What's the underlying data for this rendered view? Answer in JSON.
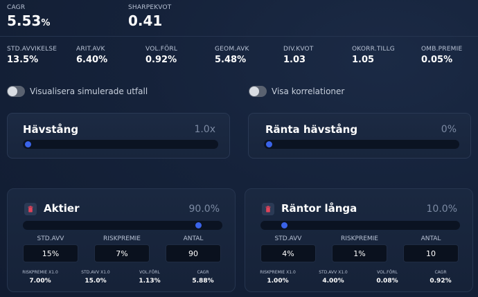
{
  "top_stats": {
    "cagr": {
      "label": "CAGR",
      "value": "5.53",
      "unit": "%"
    },
    "sharpe": {
      "label": "SHARPEKVOT",
      "value": "0.41"
    }
  },
  "metrics": [
    {
      "label": "STD.AVVIKELSE",
      "value": "13.5%"
    },
    {
      "label": "ARIT.AVK",
      "value": "6.40%"
    },
    {
      "label": "VOL.FÖRL",
      "value": "0.92%"
    },
    {
      "label": "GEOM.AVK",
      "value": "5.48%"
    },
    {
      "label": "DIV.KVOT",
      "value": "1.03"
    },
    {
      "label": "OKORR.TILLG",
      "value": "1.05"
    },
    {
      "label": "OMB.PREMIE",
      "value": "0.05%"
    }
  ],
  "toggles": {
    "simulate": {
      "label": "Visualisera simulerade utfall",
      "on": false
    },
    "correlations": {
      "label": "Visa korrelationer",
      "on": false
    }
  },
  "leverage": {
    "title": "Hävstång",
    "value": "1.0x",
    "level": 0.0
  },
  "rate_leverage": {
    "title": "Ränta hävstång",
    "value": "0%",
    "level": 0.0
  },
  "assets": [
    {
      "title": "Aktier",
      "pct": "90.0%",
      "level": 0.9,
      "inputs": {
        "std_label": "STD.AVV",
        "std": "15%",
        "risk_label": "RISKPREMIE",
        "risk": "7%",
        "count_label": "ANTAL",
        "count": "90"
      },
      "mini": [
        {
          "label": "RISKPREMIE x1.0",
          "value": "7.00%"
        },
        {
          "label": "STD.AVV x1.0",
          "value": "15.0%"
        },
        {
          "label": "VOL.FÖRL",
          "value": "1.13%"
        },
        {
          "label": "CAGR",
          "value": "5.88%"
        }
      ]
    },
    {
      "title": "Räntor långa",
      "pct": "10.0%",
      "level": 0.1,
      "inputs": {
        "std_label": "STD.AVV",
        "std": "4%",
        "risk_label": "RISKPREMIE",
        "risk": "1%",
        "count_label": "ANTAL",
        "count": "10"
      },
      "mini": [
        {
          "label": "RISKPREMIE x1.0",
          "value": "1.00%"
        },
        {
          "label": "STD.AVV x1.0",
          "value": "4.00%"
        },
        {
          "label": "VOL.FÖRL",
          "value": "0.08%"
        },
        {
          "label": "CAGR",
          "value": "0.92%"
        }
      ]
    }
  ],
  "colors": {
    "accent": "#3a63e8",
    "trash": "#e0445a"
  }
}
